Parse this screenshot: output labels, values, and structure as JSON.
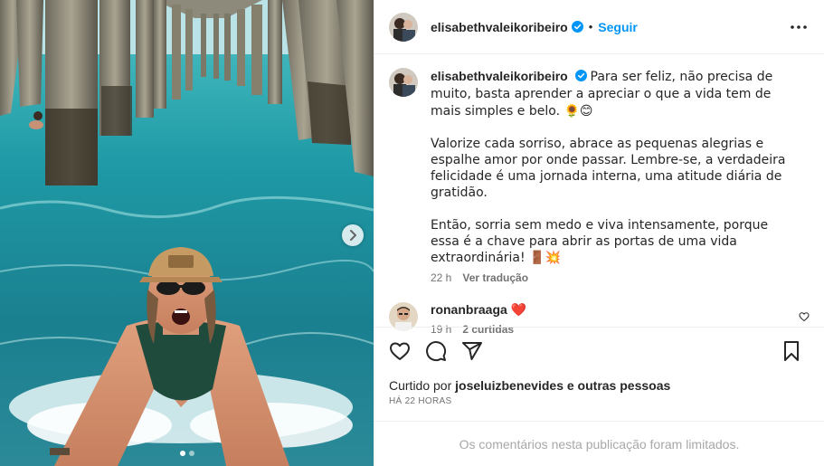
{
  "post": {
    "author": "elisabethvaleikoribeiro",
    "separator": "•",
    "follow_label": "Seguir",
    "more_icon": "more-horizontal-icon",
    "carousel": {
      "current": 1,
      "total": 2
    }
  },
  "caption": {
    "username": "elisabethvaleikoribeiro",
    "paragraphs": [
      "Para ser feliz, não precisa de muito, basta aprender a apreciar o que a vida tem de mais simples e belo. 🌻😊",
      "Valorize cada sorriso, abrace as pequenas alegrias e espalhe amor por onde passar. Lembre-se, a verdadeira felicidade é uma jornada interna, uma atitude diária de gratidão.",
      "Então, sorria sem medo e viva intensamente, porque essa é a chave para abrir as portas de uma vida extraordinária! 🚪💥"
    ],
    "time": "22 h",
    "translate_label": "Ver tradução"
  },
  "comment": {
    "username": "ronanbraaga",
    "emoji": "❤️",
    "time": "19 h",
    "likes_label": "2 curtidas"
  },
  "likes": {
    "prefix": "Curtido por",
    "user": "joseluizbenevides",
    "suffix": "e outras pessoas"
  },
  "timestamp": "HÁ 22 HORAS",
  "comments_limited": "Os comentários nesta publicação foram limitados.",
  "colors": {
    "accent": "#0095f6",
    "text": "#262626",
    "muted": "#737373",
    "heart": "#ed4956"
  }
}
